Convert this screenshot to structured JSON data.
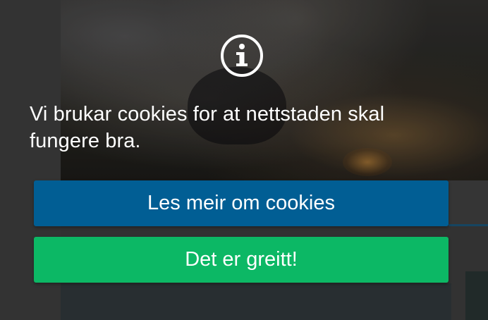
{
  "cookie_banner": {
    "message": "Vi brukar cookies for at nettstaden skal fungere bra.",
    "read_more_label": "Les meir om cookies",
    "accept_label": "Det er greitt!",
    "icon": "info-circle-icon"
  },
  "colors": {
    "read_more_button": "#015e94",
    "accept_button": "#0cb865",
    "text": "#ffffff"
  }
}
